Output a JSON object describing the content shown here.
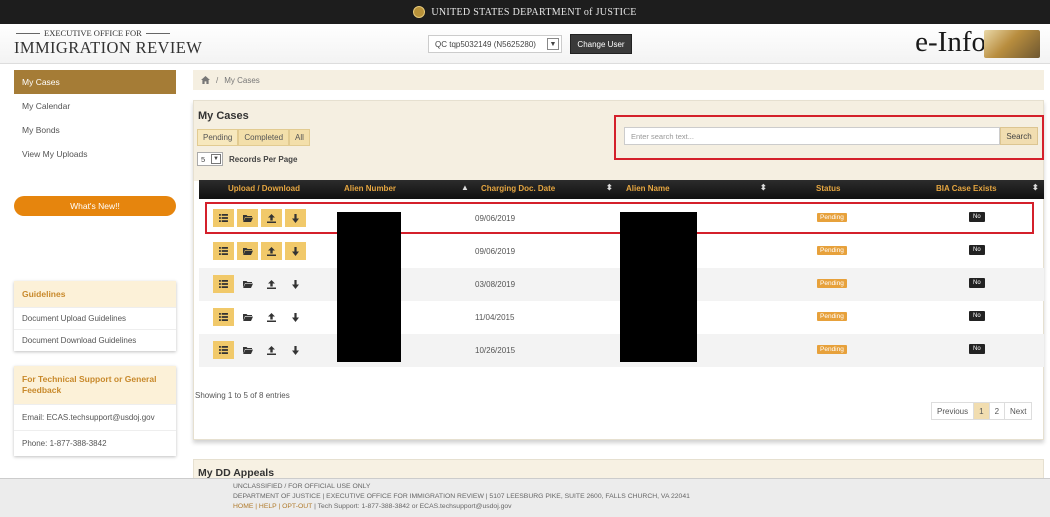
{
  "govbar": {
    "text": "UNITED STATES DEPARTMENT of JUSTICE"
  },
  "header": {
    "agency_line1": "EXECUTIVE OFFICE FOR",
    "agency_line2": "IMMIGRATION REVIEW",
    "user_select_value": "QC tqp5032149 (N5625280)",
    "change_user_label": "Change User",
    "app_name": "e-Info"
  },
  "sidebar": {
    "items": [
      {
        "label": "My Cases"
      },
      {
        "label": "My Calendar"
      },
      {
        "label": "My Bonds"
      },
      {
        "label": "View My Uploads"
      }
    ],
    "whats_new": "What's New!!",
    "guidelines": {
      "title": "Guidelines",
      "items": [
        "Document Upload Guidelines",
        "Document Download Guidelines"
      ]
    },
    "support": {
      "title": "For Technical Support or General Feedback",
      "email": "Email: ECAS.techsupport@usdoj.gov",
      "phone": "Phone: 1-877-388-3842"
    }
  },
  "breadcrumb": {
    "home_icon": "home-icon",
    "current": "My Cases"
  },
  "cases": {
    "title": "My Cases",
    "filters": [
      "Pending",
      "Completed",
      "All"
    ],
    "records_per_page_value": "5",
    "records_per_page_label": "Records Per Page",
    "search_placeholder": "Enter search text...",
    "search_button": "Search",
    "columns": [
      "Upload / Download",
      "Alien Number",
      "Charging Doc. Date",
      "Alien Name",
      "Status",
      "BIA Case Exists"
    ],
    "rows": [
      {
        "date": "09/06/2019",
        "status": "Pending",
        "bia": "No",
        "active_icons": [
          true,
          true,
          true,
          true
        ]
      },
      {
        "date": "09/06/2019",
        "status": "Pending",
        "bia": "No",
        "active_icons": [
          true,
          true,
          true,
          true
        ]
      },
      {
        "date": "03/08/2019",
        "status": "Pending",
        "bia": "No",
        "active_icons": [
          true,
          false,
          false,
          false
        ]
      },
      {
        "date": "11/04/2015",
        "status": "Pending",
        "bia": "No",
        "active_icons": [
          true,
          false,
          false,
          false
        ]
      },
      {
        "date": "10/26/2015",
        "status": "Pending",
        "bia": "No",
        "active_icons": [
          true,
          false,
          false,
          false
        ]
      }
    ],
    "showing": "Showing 1 to 5 of 8 entries",
    "pagination": [
      "Previous",
      "1",
      "2",
      "Next"
    ]
  },
  "dd_appeals": {
    "title": "My DD Appeals"
  },
  "footer": {
    "line1": "UNCLASSIFIED / FOR OFFICIAL USE ONLY",
    "line2": "DEPARTMENT OF JUSTICE | EXECUTIVE OFFICE FOR IMMIGRATION REVIEW | 5107 LEESBURG PIKE, SUITE 2600, FALLS CHURCH, VA 22041",
    "links": "HOME | HELP | OPT-OUT",
    "support": " | Tech Support: 1-877-388-3842 or ECAS.techsupport@usdoj.gov"
  }
}
